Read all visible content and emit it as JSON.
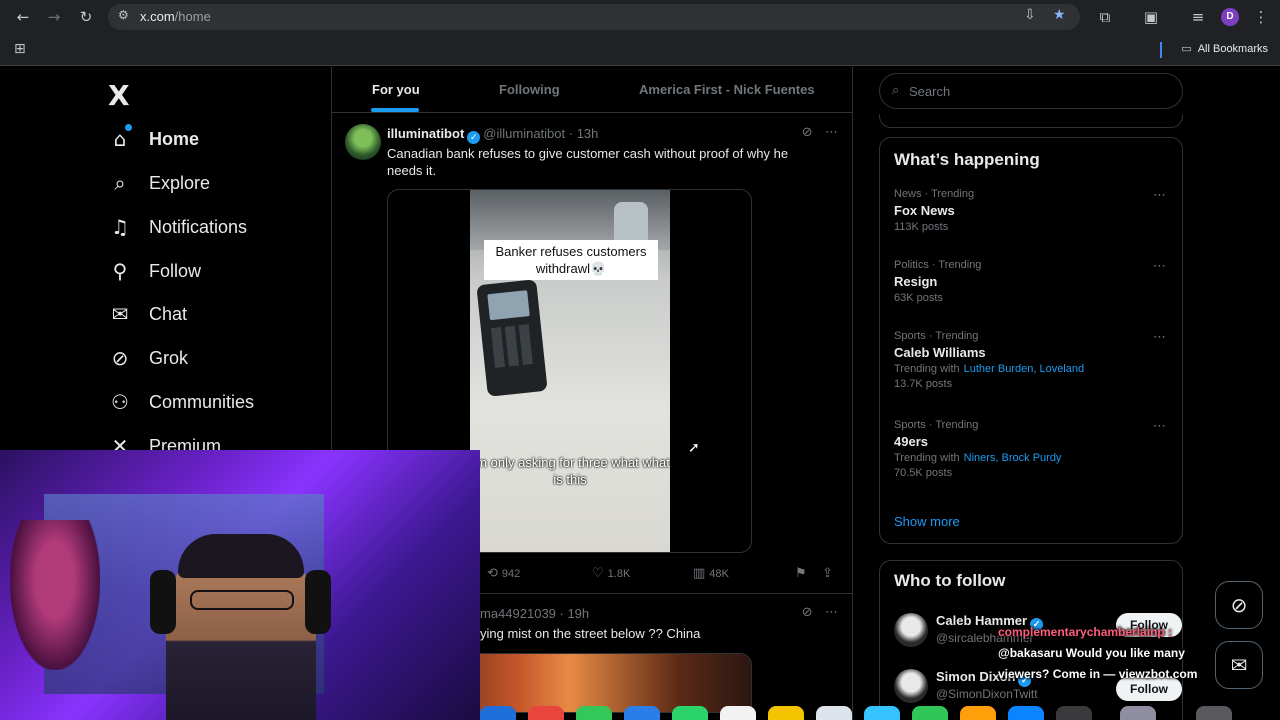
{
  "browser": {
    "url_prefix": "x.com",
    "url_path": "/home",
    "profile_initial": "D",
    "all_bookmarks": "All Bookmarks"
  },
  "nav": {
    "logo": "X",
    "items": [
      {
        "label": "Home",
        "icon": "home-icon"
      },
      {
        "label": "Explore",
        "icon": "search-icon"
      },
      {
        "label": "Notifications",
        "icon": "bell-icon"
      },
      {
        "label": "Follow",
        "icon": "person-add-icon"
      },
      {
        "label": "Chat",
        "icon": "mail-icon"
      },
      {
        "label": "Grok",
        "icon": "grok-icon"
      },
      {
        "label": "Communities",
        "icon": "people-icon"
      },
      {
        "label": "Premium",
        "icon": "x-icon"
      }
    ]
  },
  "feed": {
    "tabs": [
      "For you",
      "Following",
      "America First - Nick Fuentes"
    ],
    "tweet1": {
      "name": "illuminatibot",
      "handle": "@illuminatibot",
      "time": "· 13h",
      "text": "Canadian bank refuses to give customer cash without proof of why he needs it.",
      "video_caption": "Banker refuses customers withdrawl💀",
      "video_subtitle": "I'm only asking for three what what is this",
      "retweets": "942",
      "likes": "1.8K",
      "views": "48K"
    },
    "tweet2": {
      "header": "ma44921039 · 19h",
      "text": "ying mist on the street below ?? China"
    }
  },
  "right": {
    "search_placeholder": "Search",
    "happening_title": "What’s happening",
    "trends": [
      {
        "meta": "News · Trending",
        "name": "Fox News",
        "with": "",
        "with_links": "",
        "posts": "113K posts"
      },
      {
        "meta": "Politics · Trending",
        "name": "Resign",
        "with": "",
        "with_links": "",
        "posts": "63K posts"
      },
      {
        "meta": "Sports · Trending",
        "name": "Caleb Williams",
        "with": "Trending with",
        "with_links": "Luther Burden, Loveland",
        "posts": "13.7K posts"
      },
      {
        "meta": "Sports · Trending",
        "name": "49ers",
        "with": "Trending with",
        "with_links": "Niners, Brock Purdy",
        "posts": "70.5K posts"
      }
    ],
    "show_more": "Show more",
    "wtf_title": "Who to follow",
    "wtf": [
      {
        "name": "Caleb Hammer",
        "handle": "@sircalebhammer",
        "button": "Follow"
      },
      {
        "name": "Simon Dixon",
        "handle": "@SimonDixonTwitt",
        "button": "Follow"
      }
    ]
  },
  "overlay": {
    "chat_user": "complementarychamberlainp :",
    "chat_message": "@bakasaru Would you like many viewers? Come in — viewzbot.com"
  },
  "colors": {
    "accent": "#1d9bf0",
    "background": "#000000",
    "border": "#2f3336",
    "webcam_purple": "#8a33ff"
  }
}
